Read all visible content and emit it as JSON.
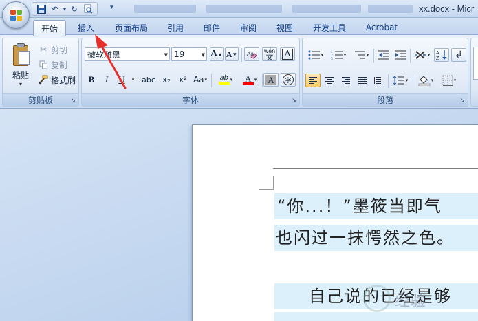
{
  "title_bar": {
    "window_title": "xx.docx - Micr",
    "quick_access": [
      "save-icon",
      "undo-icon",
      "redo-icon",
      "print-preview-icon"
    ]
  },
  "tabs": [
    {
      "label": "开始",
      "active": true
    },
    {
      "label": "插入"
    },
    {
      "label": "页面布局"
    },
    {
      "label": "引用"
    },
    {
      "label": "邮件"
    },
    {
      "label": "审阅"
    },
    {
      "label": "视图"
    },
    {
      "label": "开发工具"
    },
    {
      "label": "Acrobat"
    }
  ],
  "clipboard": {
    "paste_label": "粘贴",
    "cut_label": "剪切",
    "copy_label": "复制",
    "format_painter_label": "格式刷",
    "group_label": "剪贴板"
  },
  "font": {
    "font_name": "微软雅黑",
    "font_size": "19",
    "group_label": "字体",
    "change_case_label": "Aa",
    "bold": "B",
    "italic": "I",
    "underline": "U",
    "strikethrough": "abc",
    "subscript": "x₂",
    "superscript": "x²",
    "grow_font": "A",
    "shrink_font": "A",
    "phonetic": "wén",
    "phonetic_base": "文",
    "char_border": "A",
    "char_shading": "A",
    "enclose": "字",
    "highlight": "ab",
    "font_color": "A"
  },
  "paragraph": {
    "group_label": "段落"
  },
  "document": {
    "line1": "“你...！”墨筱当即气",
    "line2": "也闪过一抹愕然之色。",
    "line3": "自己说的已经是够",
    "watermark": "经验"
  },
  "colors": {
    "highlight_yellow": "#ffff00",
    "font_red": "#ff0000",
    "annotation_red": "#e8302a",
    "text_highlight_bg": "#dcf0fb"
  }
}
